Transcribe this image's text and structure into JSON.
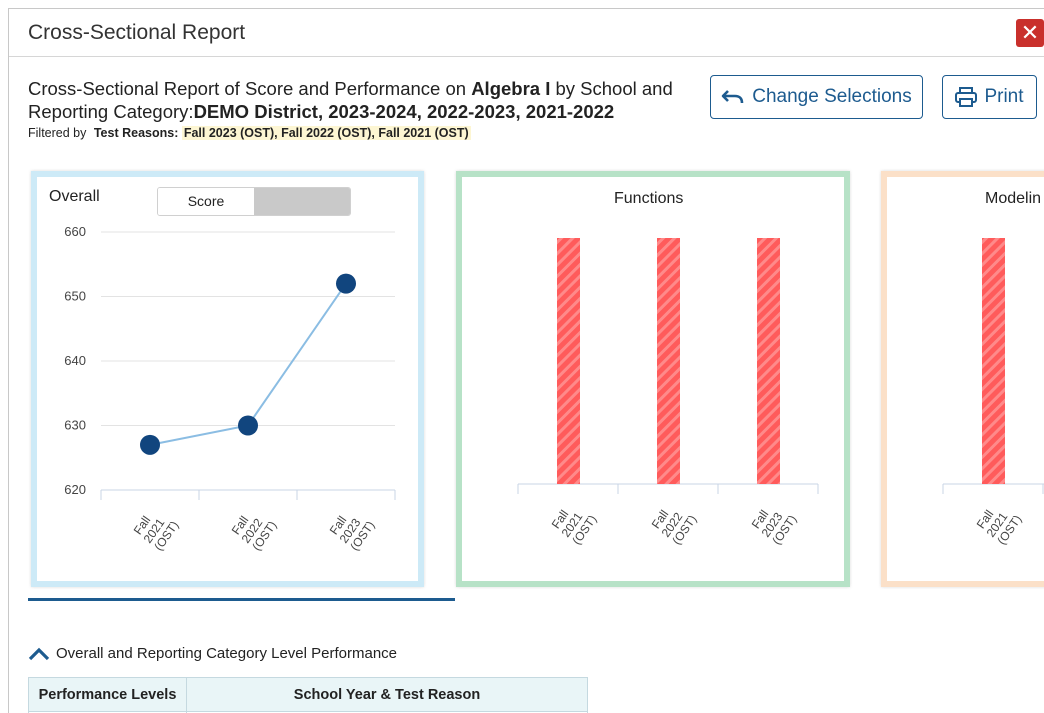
{
  "dialog": {
    "title": "Cross-Sectional Report",
    "close_label": "✕"
  },
  "heading": {
    "prefix": "Cross-Sectional Report of Score and Performance on ",
    "subject": "Algebra I",
    "middle": " by School and Reporting Category:",
    "district": "DEMO District",
    "years": ", 2023-2024, 2022-2023, 2021-2022",
    "filtered_by": "Filtered by",
    "reasons_label": "Test Reasons:",
    "reasons": "Fall 2023 (OST), Fall 2022 (OST), Fall 2021 (OST)"
  },
  "toolbar": {
    "change_label": "Change Selections",
    "print_label": "Print",
    "change_icon": "undo-arrow-icon",
    "print_icon": "printer-icon"
  },
  "panels": {
    "overall": {
      "title": "Overall",
      "toggle_selected": "Score",
      "color": "#cdeaf7"
    },
    "functions": {
      "title": "Functions",
      "color": "#b7e2c7"
    },
    "modeling": {
      "title": "Modelin",
      "color": "#fbe0c8"
    }
  },
  "chart_data": [
    {
      "type": "line",
      "title": "Overall",
      "categories": [
        "Fall 2021 (OST)",
        "Fall 2022 (OST)",
        "Fall 2023 (OST)"
      ],
      "tick_lines": [
        [
          "Fall",
          "2021",
          "(OST)"
        ],
        [
          "Fall",
          "2022",
          "(OST)"
        ],
        [
          "Fall",
          "2023",
          "(OST)"
        ]
      ],
      "values": [
        627,
        630,
        652
      ],
      "yticks": [
        620,
        630,
        640,
        650,
        660
      ],
      "ylim": [
        620,
        660
      ],
      "grid": true,
      "line_color": "#8bbde3",
      "marker_color": "#11457e"
    },
    {
      "type": "bar",
      "title": "Functions",
      "categories": [
        "Fall 2021 (OST)",
        "Fall 2022 (OST)",
        "Fall 2023 (OST)"
      ],
      "tick_lines": [
        [
          "Fall",
          "2021",
          "(OST)"
        ],
        [
          "Fall",
          "2022",
          "(OST)"
        ],
        [
          "Fall",
          "2023",
          "(OST)"
        ]
      ],
      "values": [
        1,
        1,
        1
      ],
      "ylim": [
        0,
        1
      ],
      "bar_color": "#ff5b5b",
      "pattern": "diagonal-stripes"
    },
    {
      "type": "bar",
      "title": "Modelin",
      "categories": [
        "Fall 2021 (OST)"
      ],
      "tick_lines": [
        [
          "Fall",
          "2021",
          "(OST)"
        ]
      ],
      "values": [
        1
      ],
      "ylim": [
        0,
        1
      ],
      "bar_color": "#ff5b5b",
      "pattern": "diagonal-stripes"
    }
  ],
  "section": {
    "toggle_label": "Overall and Reporting Category Level Performance",
    "toggle_icon": "chevron-up-icon"
  },
  "table": {
    "headers": [
      "Performance Levels",
      "School Year & Test Reason"
    ]
  }
}
